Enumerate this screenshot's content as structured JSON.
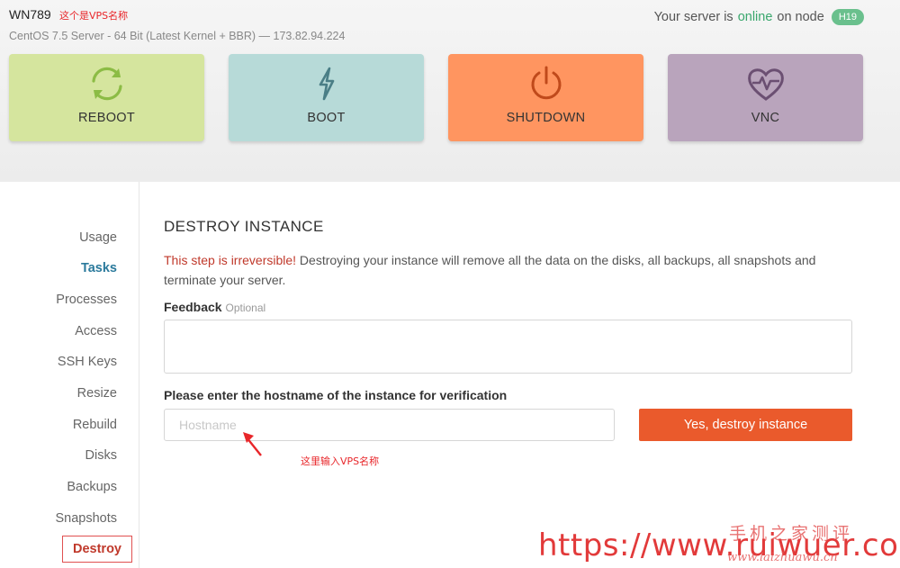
{
  "header": {
    "server_name": "WN789",
    "server_name_annotation": "这个是VPS名称",
    "server_info": "CentOS 7.5 Server - 64 Bit (Latest Kernel + BBR) — 173.82.94.224",
    "status_prefix": "Your server is",
    "status_value": "online",
    "status_mid": "on node",
    "node": "H19"
  },
  "actions": [
    {
      "label": "REBOOT",
      "icon": "refresh-icon",
      "color": "#d5e59e",
      "icon_color": "#8cbc45"
    },
    {
      "label": "BOOT",
      "icon": "lightning-icon",
      "color": "#b7dad8",
      "icon_color": "#4a7e86"
    },
    {
      "label": "SHUTDOWN",
      "icon": "power-icon",
      "color": "#ff9560",
      "icon_color": "#c04a1b"
    },
    {
      "label": "VNC",
      "icon": "heart-pulse-icon",
      "color": "#b9a4bc",
      "icon_color": "#6b4f72"
    }
  ],
  "sidebar": {
    "items": [
      {
        "label": "Usage"
      },
      {
        "label": "Tasks"
      },
      {
        "label": "Processes"
      },
      {
        "label": "Access"
      },
      {
        "label": "SSH Keys"
      },
      {
        "label": "Resize"
      },
      {
        "label": "Rebuild"
      },
      {
        "label": "Disks"
      },
      {
        "label": "Backups"
      },
      {
        "label": "Snapshots"
      },
      {
        "label": "Destroy"
      }
    ]
  },
  "main": {
    "title": "DESTROY INSTANCE",
    "warning_highlight": "This step is irreversible!",
    "warning_text": " Destroying your instance will remove all the data on the disks, all backups, all snapshots and terminate your server.",
    "feedback_label": "Feedback",
    "feedback_optional": "Optional",
    "feedback_value": "",
    "hostname_label": "Please enter the hostname of the instance for verification",
    "hostname_placeholder": "Hostname",
    "hostname_value": "",
    "destroy_button": "Yes, destroy instance",
    "input_annotation": "这里输入VPS名称"
  },
  "watermark": {
    "title_cn": "手机之家测评",
    "url": "https://www.ruiwuer.com",
    "sub": "www.laizhuawu.cn"
  },
  "colors": {
    "accent_active": "#2b7a9c",
    "danger": "#ea5a2c",
    "online": "#3aa76d",
    "annotation": "#e8262a"
  }
}
